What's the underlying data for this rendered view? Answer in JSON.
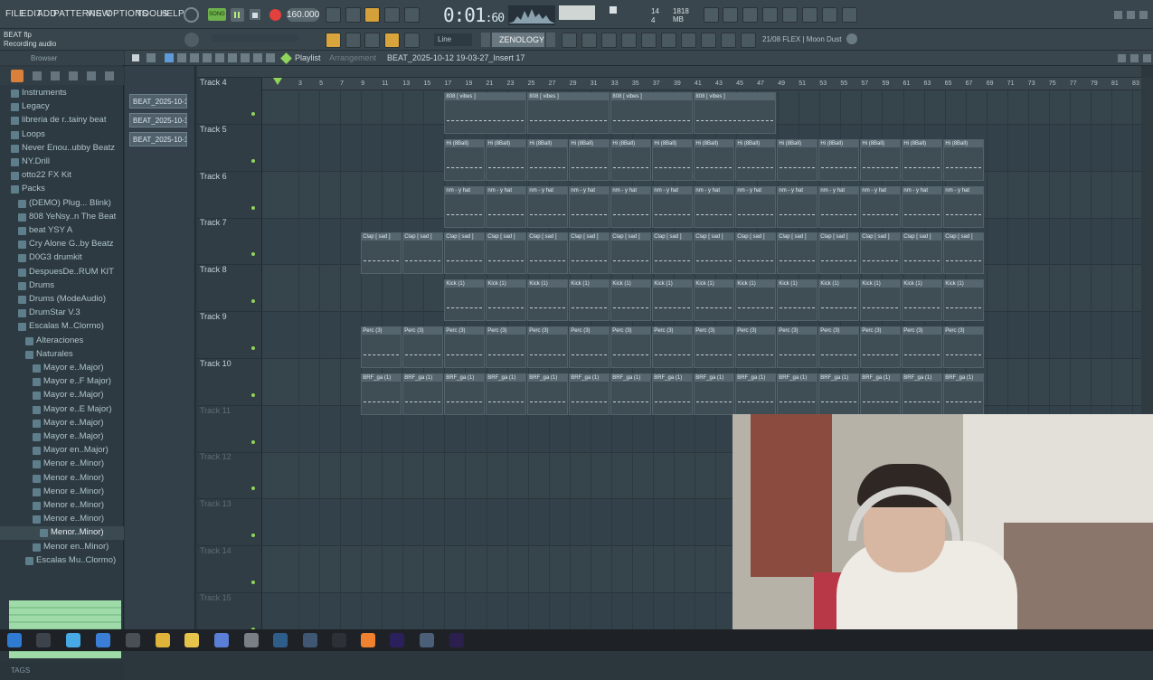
{
  "menu": [
    "FILE",
    "EDIT",
    "ADD",
    "PATTERNS",
    "VIEW",
    "OPTIONS",
    "TOOLS",
    "HELP"
  ],
  "hint": {
    "line1": "BEAT flp",
    "line2": "Recording audio"
  },
  "transport": {
    "tempo": "160.000",
    "time_main": "0:01",
    "time_sub": "60",
    "mode": "SONG"
  },
  "cpu": {
    "voices": "14",
    "memory": "1818 MB",
    "sub": "4"
  },
  "toolbar2": {
    "snap": "Line",
    "preset": "ZENOLOGY",
    "news": "21/08 FLEX | Moon Dust"
  },
  "browser": {
    "title": "Browser",
    "items": [
      {
        "label": "Instruments",
        "indent": 1
      },
      {
        "label": "Legacy",
        "indent": 1
      },
      {
        "label": "libreria de r..tainy beat",
        "indent": 1
      },
      {
        "label": "Loops",
        "indent": 1
      },
      {
        "label": "Never Enou..ubby Beatz",
        "indent": 1
      },
      {
        "label": "NY.Drill",
        "indent": 1
      },
      {
        "label": "otto22 FX Kit",
        "indent": 1
      },
      {
        "label": "Packs",
        "indent": 1
      },
      {
        "label": "(DEMO) Plug... Blink)",
        "indent": 2
      },
      {
        "label": "808 YeNsy..n The Beat",
        "indent": 2
      },
      {
        "label": "beat YSY A",
        "indent": 2
      },
      {
        "label": "Cry Alone G..by Beatz",
        "indent": 2
      },
      {
        "label": "D0G3 drumkit",
        "indent": 2
      },
      {
        "label": "DespuesDe..RUM KIT",
        "indent": 2
      },
      {
        "label": "Drums",
        "indent": 2
      },
      {
        "label": "Drums (ModeAudio)",
        "indent": 2
      },
      {
        "label": "DrumStar V.3",
        "indent": 2
      },
      {
        "label": "Escalas M..Clormo)",
        "indent": 2
      },
      {
        "label": "Alteraciones",
        "indent": 3
      },
      {
        "label": "Naturales",
        "indent": 3
      },
      {
        "label": "Mayor e..Major)",
        "indent": 4
      },
      {
        "label": "Mayor e..F Major)",
        "indent": 4
      },
      {
        "label": "Mayor e..Major)",
        "indent": 4
      },
      {
        "label": "Mayor e..E Major)",
        "indent": 4
      },
      {
        "label": "Mayor e..Major)",
        "indent": 4
      },
      {
        "label": "Mayor e..Major)",
        "indent": 4
      },
      {
        "label": "Mayor en..Major)",
        "indent": 4
      },
      {
        "label": "Menor e..Minor)",
        "indent": 4
      },
      {
        "label": "Menor e..Minor)",
        "indent": 4
      },
      {
        "label": "Menor e..Minor)",
        "indent": 4
      },
      {
        "label": "Menor e..Minor)",
        "indent": 4
      },
      {
        "label": "Menor e..Minor)",
        "indent": 4
      },
      {
        "label": "Menor..Minor)",
        "indent": 5,
        "selected": true
      },
      {
        "label": "Menor en..Minor)",
        "indent": 4
      },
      {
        "label": "Escalas Mu..Clormo)",
        "indent": 3
      }
    ],
    "tags": "TAGS"
  },
  "clip_list": [
    "BEAT_2025-10-1...",
    "BEAT_2025-10-1...",
    "BEAT_2025-10-1..."
  ],
  "playlist": {
    "title": "Playlist",
    "subtitle": "Arrangement",
    "pattern": "BEAT_2025-10-12 19-03-27_Insert 17",
    "ruler": [
      "3",
      "5",
      "7",
      "9",
      "11",
      "13",
      "15",
      "17",
      "19",
      "21",
      "23",
      "25",
      "27",
      "29",
      "31",
      "33",
      "35",
      "37",
      "39",
      "41",
      "43",
      "45",
      "47",
      "49",
      "51",
      "53",
      "55",
      "57",
      "59",
      "61",
      "63",
      "65",
      "67",
      "69",
      "71",
      "73",
      "75",
      "77",
      "79",
      "81",
      "83"
    ],
    "tracks": [
      {
        "name": "Track 4",
        "active": true
      },
      {
        "name": "Track 5",
        "active": true
      },
      {
        "name": "Track 6",
        "active": true
      },
      {
        "name": "Track 7",
        "active": true
      },
      {
        "name": "Track 8",
        "active": true
      },
      {
        "name": "Track 9",
        "active": true
      },
      {
        "name": "Track 10",
        "active": true
      },
      {
        "name": "Track 11",
        "active": false
      },
      {
        "name": "Track 12",
        "active": false
      },
      {
        "name": "Track 13",
        "active": false
      },
      {
        "name": "Track 14",
        "active": false
      },
      {
        "name": "Track 15",
        "active": false
      }
    ],
    "clip_rows": [
      {
        "label": "808 [ vibes ]",
        "count": 4,
        "row": 0,
        "start": 17
      },
      {
        "label": "Hi (8Ball)",
        "count": 13,
        "row": 1,
        "start": 17
      },
      {
        "label": "nm - y hat",
        "count": 13,
        "row": 2,
        "start": 17
      },
      {
        "label": "Clap [ sad ]",
        "count": 15,
        "row": 3,
        "start": 9
      },
      {
        "label": "Kick (1)",
        "count": 13,
        "row": 4,
        "start": 17
      },
      {
        "label": "Perc (3)",
        "count": 15,
        "row": 5,
        "start": 9
      },
      {
        "label": "BRF_ga (1)",
        "count": 15,
        "row": 6,
        "start": 9
      }
    ]
  },
  "colors": {
    "accent": "#e2413d",
    "wave": "#9fdba9",
    "bg": "#2b363d"
  }
}
